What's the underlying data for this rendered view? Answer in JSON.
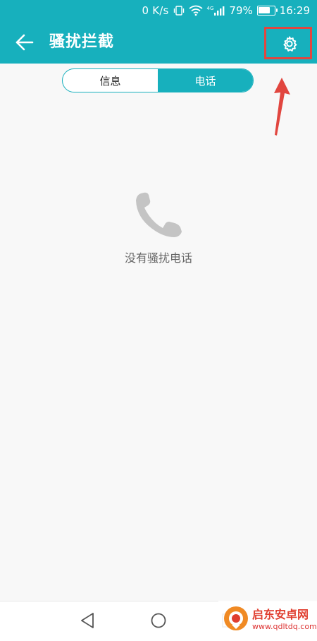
{
  "status_bar": {
    "network_speed": "0 K/s",
    "network_type": "4G",
    "battery": "79%",
    "battery_level": 0.79,
    "time": "16:29"
  },
  "app_bar": {
    "title": "骚扰拦截",
    "back_icon": "arrow-left-icon",
    "settings_icon": "gear-icon"
  },
  "tabs": [
    {
      "label": "信息",
      "active": false
    },
    {
      "label": "电话",
      "active": true
    }
  ],
  "empty_state": {
    "icon": "phone-icon",
    "message": "没有骚扰电话"
  },
  "annotation": {
    "highlight_color": "#e1463f"
  },
  "navigation_bar": {
    "back_icon": "triangle-back-icon",
    "home_icon": "circle-home-icon",
    "recents_icon": "square-recents-icon"
  },
  "watermark": {
    "title": "启东安卓网",
    "url": "www.qdltdq.com"
  },
  "colors": {
    "primary": "#17b0bd",
    "background": "#f8f8f8",
    "annotation_red": "#e1463f"
  }
}
